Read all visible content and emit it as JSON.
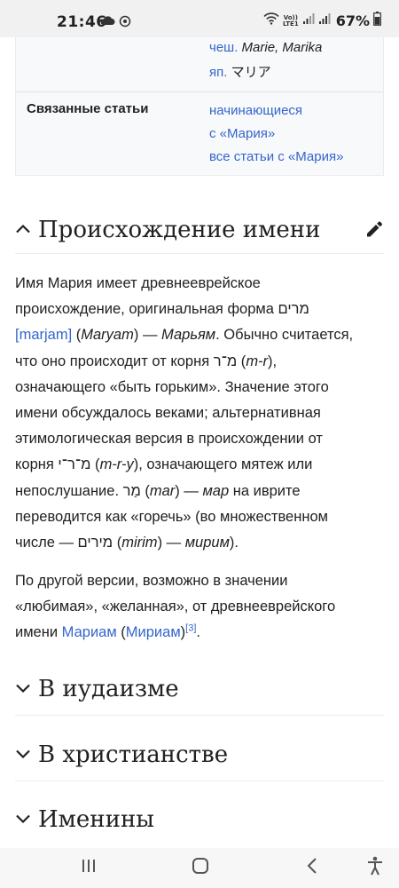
{
  "status_bar": {
    "time": "21:46",
    "volte_label_top": "Vo))",
    "volte_label_bottom": "LTE1",
    "battery": "67%"
  },
  "infobox": {
    "rows": [
      {
        "lang": "чеш.",
        "value": "Marie, Marika"
      },
      {
        "lang": "яп.",
        "value": "マリア"
      }
    ],
    "related_label": "Связанные статьи",
    "related_links": [
      "начинающиеся",
      "с «Мария»",
      "все статьи с «Мария»"
    ]
  },
  "sections": {
    "origin": {
      "title": "Происхождение имени",
      "expanded": true
    },
    "judaism": {
      "title": "В иудаизме",
      "expanded": false
    },
    "christianity": {
      "title": "В христианстве",
      "expanded": false
    },
    "nameday": {
      "title": "Именины",
      "expanded": false
    }
  },
  "paragraph1": {
    "l1": "Имя Мария имеет древнееврейское",
    "l2_text": "происхождение, оригинальная форма ",
    "l2_hebrew": "מרים",
    "l3_link": "[marjam]",
    "l3_open": " (",
    "l3_italic1": "Maryam",
    "l3_mid": ") — ",
    "l3_italic2": "Марьям",
    "l3_rest": ". Обычно считается,",
    "l4_text": "что оно происходит от корня ",
    "l4_hebrew": "מ־ר",
    "l4_open": " (",
    "l4_italic": "m-r",
    "l4_close": "),",
    "l5": "означающего «быть горьким». Значение этого",
    "l6": "имени обсуждалось веками; альтернативная",
    "l7": "этимологическая версия в происхождении от",
    "l8_text": "корня ",
    "l8_hebrew": "מ־ר־י",
    "l8_open": " (",
    "l8_italic": "m-r-y",
    "l8_rest": "), означающего мятеж или",
    "l9_text": "непослушание. ",
    "l9_hebrew": "מַר",
    "l9_open": " (",
    "l9_italic1": "mar",
    "l9_mid": ") — ",
    "l9_italic2": "мар",
    "l9_rest": " на иврите",
    "l10": "переводится как «горечь» (во множественном",
    "l11_text": "числе — ",
    "l11_hebrew": "מירים",
    "l11_open": " (",
    "l11_italic1": "mirim",
    "l11_mid": ") — ",
    "l11_italic2": "мирим",
    "l11_close": ")."
  },
  "paragraph2": {
    "l1": "По другой версии, возможно в значении",
    "l2": "«любимая», «желанная», от древнееврейского",
    "l3_text": "имени ",
    "l3_link1": "Мариам",
    "l3_open": " (",
    "l3_link2": "Мириам",
    "l3_close": ")",
    "l3_ref": "[3]",
    "l3_end": "."
  },
  "colors": {
    "link": "#3366cc",
    "text": "#202122",
    "infobox_bg": "#f8f9fa",
    "status_bar_bg": "#f1f1f1"
  },
  "icons": [
    "cloud-icon",
    "wifi-icon",
    "signal-icon",
    "battery-icon",
    "chevron-up-icon",
    "chevron-down-icon",
    "pencil-icon",
    "recent-apps-icon",
    "home-icon",
    "back-icon",
    "accessibility-icon"
  ]
}
